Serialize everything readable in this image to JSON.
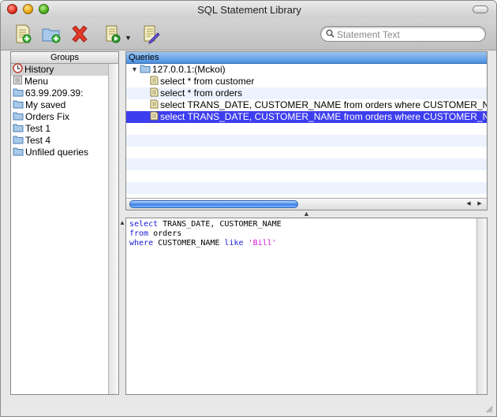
{
  "window": {
    "title": "SQL Statement Library"
  },
  "search": {
    "placeholder": "Statement Text"
  },
  "groups": {
    "header": "Groups",
    "items": [
      {
        "label": "History",
        "icon": "history-clock-icon",
        "selected": true
      },
      {
        "label": "Menu",
        "icon": "menu-list-icon"
      },
      {
        "label": "63.99.209.39:",
        "icon": "folder-icon"
      },
      {
        "label": "My saved",
        "icon": "folder-icon"
      },
      {
        "label": "Orders Fix",
        "icon": "folder-icon"
      },
      {
        "label": "Test 1",
        "icon": "folder-icon"
      },
      {
        "label": "Test 4",
        "icon": "folder-icon"
      },
      {
        "label": "Unfiled queries",
        "icon": "folder-icon"
      }
    ]
  },
  "queries": {
    "header": "Queries",
    "server": "127.0.0.1:(Mckoi)",
    "items": [
      {
        "label": "select * from customer"
      },
      {
        "label": "select * from orders"
      },
      {
        "label": "select TRANS_DATE, CUSTOMER_NAME from orders where CUSTOMER_NAME like 'Bill'"
      },
      {
        "label": "select TRANS_DATE, CUSTOMER_NAME from orders where CUSTOMER_NAME like 'Bill'",
        "selected": true
      }
    ]
  },
  "editor": {
    "lines": [
      {
        "kw": "select",
        "rest": " TRANS_DATE, CUSTOMER_NAME"
      },
      {
        "kw": "from",
        "rest": " orders"
      },
      {
        "kw": "where",
        "rest": " CUSTOMER_NAME ",
        "kw2": "like",
        "str": "'Bill'"
      }
    ]
  },
  "colors": {
    "selection": "#3d3df0",
    "keyword": "#1a1ad6",
    "string": "#d21ad2",
    "header": "#4a8fe0"
  }
}
